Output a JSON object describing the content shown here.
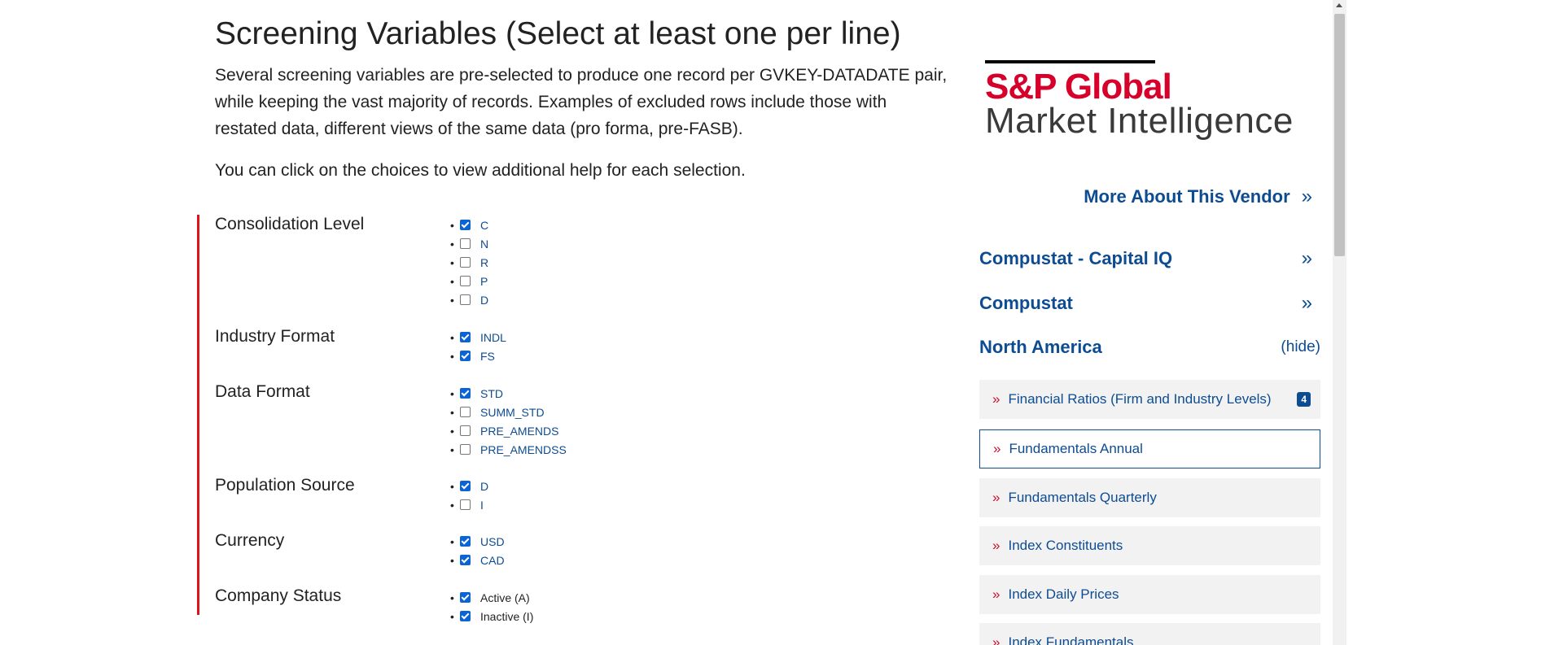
{
  "title": "Screening Variables (Select at least one per line)",
  "intro": "Several screening variables are pre-selected to produce one record per GVKEY-DATADATE pair, while keeping the vast majority of records. Examples of excluded rows include those with restated data, different views of the same data (pro forma, pre-FASB).",
  "help_line": "You can click on the choices to view additional help for each selection.",
  "variables": [
    {
      "label": "Consolidation Level",
      "options": [
        {
          "text": "C",
          "checked": true
        },
        {
          "text": "N",
          "checked": false
        },
        {
          "text": "R",
          "checked": false
        },
        {
          "text": "P",
          "checked": false
        },
        {
          "text": "D",
          "checked": false
        }
      ]
    },
    {
      "label": "Industry Format",
      "options": [
        {
          "text": "INDL",
          "checked": true
        },
        {
          "text": "FS",
          "checked": true
        }
      ]
    },
    {
      "label": "Data Format",
      "options": [
        {
          "text": "STD",
          "checked": true
        },
        {
          "text": "SUMM_STD",
          "checked": false
        },
        {
          "text": "PRE_AMENDS",
          "checked": false
        },
        {
          "text": "PRE_AMENDSS",
          "checked": false
        }
      ]
    },
    {
      "label": "Population Source",
      "options": [
        {
          "text": "D",
          "checked": true
        },
        {
          "text": "I",
          "checked": false
        }
      ]
    },
    {
      "label": "Currency",
      "options": [
        {
          "text": "USD",
          "checked": true
        },
        {
          "text": "CAD",
          "checked": true
        }
      ]
    },
    {
      "label": "Company Status",
      "options": [
        {
          "text": "Active (A)",
          "checked": true
        },
        {
          "text": "Inactive (I)",
          "checked": true
        }
      ]
    }
  ],
  "logo": {
    "brand": "S&P Global",
    "tagline": "Market Intelligence",
    "brand_color": "#d6002a"
  },
  "sidebar": {
    "more_vendor": "More About This Vendor",
    "nav": [
      {
        "label": "Compustat - Capital IQ",
        "action": "»"
      },
      {
        "label": "Compustat",
        "action": "»"
      },
      {
        "label": "North America",
        "action": "(hide)"
      }
    ],
    "items": [
      {
        "label": "Financial Ratios (Firm and Industry Levels)",
        "badge": "4",
        "active": false
      },
      {
        "label": "Fundamentals Annual",
        "badge": "",
        "active": true
      },
      {
        "label": "Fundamentals Quarterly",
        "badge": "",
        "active": false
      },
      {
        "label": "Index Constituents",
        "badge": "",
        "active": false
      },
      {
        "label": "Index Daily Prices",
        "badge": "",
        "active": false
      },
      {
        "label": "Index Fundamentals",
        "badge": "",
        "active": false
      }
    ]
  },
  "colors": {
    "link": "#0e4c92",
    "accent_red": "#e0121b",
    "checkbox": "#0b64d6"
  }
}
